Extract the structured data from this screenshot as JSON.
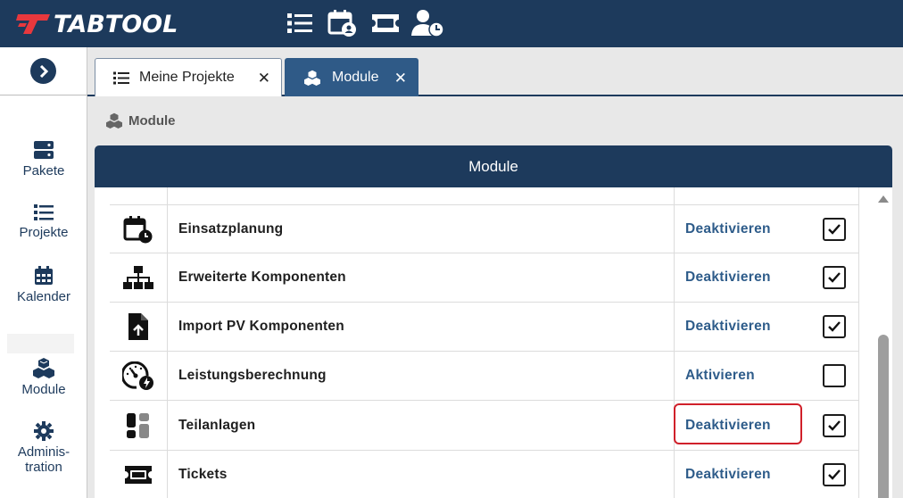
{
  "app": {
    "logo_text": "TABTOOL",
    "colors": {
      "navy": "#1d3a5c",
      "tab_active": "#2f5a87",
      "link": "#2e5c8a",
      "highlight": "#d0202a"
    }
  },
  "topbar": {
    "icons": [
      "list-icon",
      "calendar-person-icon",
      "ticket-icon",
      "user-clock-icon"
    ]
  },
  "sidebar": {
    "items": [
      {
        "label": "Pakete",
        "icon": "server-icon"
      },
      {
        "label": "Projekte",
        "icon": "list-icon"
      },
      {
        "label": "Kalender",
        "icon": "calendar-icon"
      },
      {
        "label": "Module",
        "icon": "cubes-icon"
      },
      {
        "label": "Adminis-",
        "label2": "tration",
        "icon": "gear-icon"
      }
    ]
  },
  "tabs": [
    {
      "label": "Meine Projekte",
      "close": "✕",
      "active": false
    },
    {
      "label": "Module",
      "close": "✕",
      "active": true
    }
  ],
  "breadcrumb": {
    "label": "Module"
  },
  "panel": {
    "title": "Module",
    "rows": [
      {
        "name": "Einsatzplanung",
        "action": "Deaktivieren",
        "checked": true,
        "icon": "calendar-clock-icon"
      },
      {
        "name": "Erweiterte Komponenten",
        "action": "Deaktivieren",
        "checked": true,
        "icon": "sitemap-icon"
      },
      {
        "name": "Import PV Komponenten",
        "action": "Deaktivieren",
        "checked": true,
        "icon": "file-upload-icon"
      },
      {
        "name": "Leistungsberechnung",
        "action": "Aktivieren",
        "checked": false,
        "icon": "gauge-bolt-icon"
      },
      {
        "name": "Teilanlagen",
        "action": "Deaktivieren",
        "checked": true,
        "icon": "blocks-icon"
      },
      {
        "name": "Tickets",
        "action": "Deaktivieren",
        "checked": true,
        "icon": "ticket-icon"
      }
    ]
  }
}
